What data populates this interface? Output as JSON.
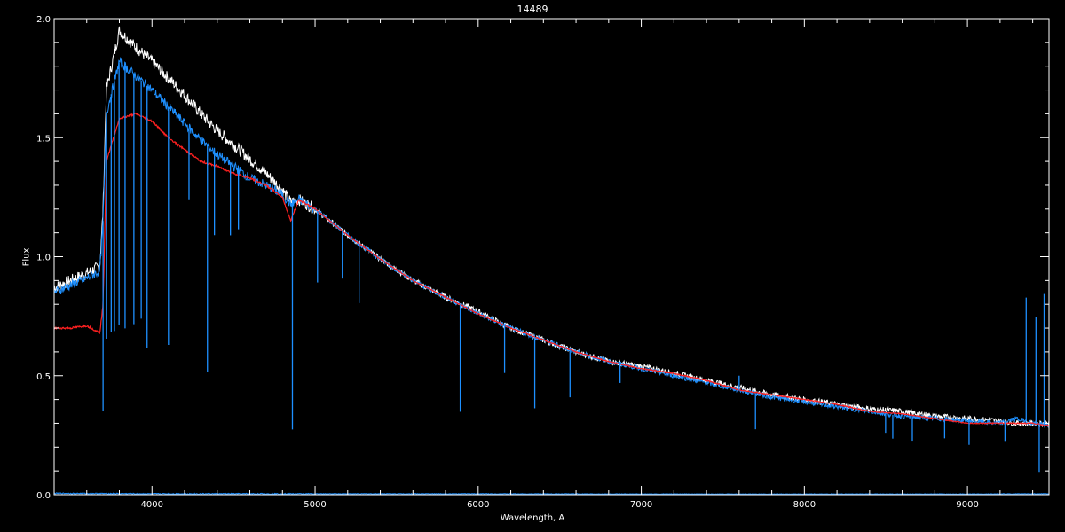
{
  "chart_data": {
    "type": "line",
    "title": "14489",
    "xlabel": "Wavelength, A",
    "ylabel": "Flux",
    "xlim": [
      3400,
      9500
    ],
    "ylim": [
      0.0,
      2.0
    ],
    "xticks": [
      4000,
      5000,
      6000,
      7000,
      8000,
      9000
    ],
    "xtick_labels": [
      "4000",
      "5000",
      "6000",
      "7000",
      "8000",
      "9000"
    ],
    "yticks": [
      0.0,
      0.5,
      1.0,
      1.5,
      2.0
    ],
    "ytick_labels": [
      "0.0",
      "0.5",
      "1.0",
      "1.5",
      "2.0"
    ],
    "grid": false,
    "series": [
      {
        "color": "#ffffff",
        "x": [
          3400,
          3500,
          3600,
          3680,
          3700,
          3720,
          3800,
          3900,
          4000,
          4100,
          4200,
          4300,
          4400,
          4500,
          4600,
          4700,
          4800,
          4850,
          4900,
          5000,
          5200,
          5400,
          5600,
          5800,
          6000,
          6200,
          6400,
          6600,
          6800,
          7000,
          7200,
          7400,
          7600,
          7800,
          8000,
          8200,
          8400,
          8600,
          8800,
          9000,
          9200,
          9300,
          9400,
          9500
        ],
        "y": [
          0.87,
          0.9,
          0.93,
          0.96,
          1.2,
          1.7,
          1.95,
          1.88,
          1.82,
          1.75,
          1.68,
          1.6,
          1.53,
          1.47,
          1.41,
          1.35,
          1.28,
          1.23,
          1.24,
          1.2,
          1.09,
          0.99,
          0.9,
          0.83,
          0.77,
          0.7,
          0.65,
          0.6,
          0.56,
          0.54,
          0.51,
          0.48,
          0.45,
          0.42,
          0.4,
          0.38,
          0.36,
          0.35,
          0.33,
          0.32,
          0.31,
          0.3,
          0.3,
          0.3
        ]
      },
      {
        "color": "#1e90ff",
        "x": [
          3400,
          3500,
          3600,
          3680,
          3700,
          3720,
          3800,
          3900,
          4000,
          4100,
          4200,
          4300,
          4400,
          4500,
          4600,
          4700,
          4800,
          4850,
          4900,
          5000,
          5200,
          5400,
          5600,
          5800,
          6000,
          6200,
          6400,
          6600,
          6800,
          7000,
          7200,
          7400,
          7600,
          7800,
          8000,
          8200,
          8400,
          8600,
          8800,
          9000,
          9200,
          9300,
          9400,
          9500
        ],
        "y": [
          0.85,
          0.88,
          0.91,
          0.94,
          1.15,
          1.6,
          1.82,
          1.76,
          1.7,
          1.63,
          1.56,
          1.49,
          1.43,
          1.38,
          1.33,
          1.3,
          1.26,
          1.22,
          1.24,
          1.2,
          1.09,
          0.99,
          0.9,
          0.83,
          0.76,
          0.7,
          0.65,
          0.6,
          0.56,
          0.53,
          0.5,
          0.47,
          0.44,
          0.41,
          0.39,
          0.37,
          0.35,
          0.33,
          0.32,
          0.31,
          0.3,
          0.32,
          0.3,
          0.29
        ]
      },
      {
        "color": "#ff2020",
        "x": [
          3400,
          3500,
          3600,
          3680,
          3700,
          3720,
          3800,
          3900,
          4000,
          4100,
          4200,
          4300,
          4400,
          4500,
          4600,
          4700,
          4800,
          4850,
          4900,
          5000,
          5200,
          5400,
          5600,
          5800,
          6000,
          6200,
          6400,
          6600,
          6800,
          7000,
          7200,
          7400,
          7600,
          7800,
          8000,
          8200,
          8400,
          8600,
          8800,
          9000,
          9200,
          9300,
          9400,
          9500
        ],
        "y": [
          0.7,
          0.7,
          0.71,
          0.68,
          0.8,
          1.4,
          1.58,
          1.6,
          1.57,
          1.5,
          1.45,
          1.4,
          1.38,
          1.35,
          1.33,
          1.3,
          1.25,
          1.15,
          1.24,
          1.2,
          1.09,
          0.99,
          0.9,
          0.83,
          0.76,
          0.7,
          0.65,
          0.6,
          0.56,
          0.53,
          0.51,
          0.48,
          0.44,
          0.42,
          0.4,
          0.38,
          0.35,
          0.34,
          0.32,
          0.3,
          0.3,
          0.3,
          0.3,
          0.29
        ]
      },
      {
        "color": "#1e90ff",
        "x": [
          3400,
          4000,
          5000,
          6000,
          7000,
          8000,
          9000,
          9500
        ],
        "y": [
          0.006,
          0.004,
          0.004,
          0.004,
          0.003,
          0.003,
          0.003,
          0.004
        ]
      }
    ],
    "absorption_lines": [
      {
        "x": 3700,
        "depth": 0.8
      },
      {
        "x": 3722,
        "depth": 0.95
      },
      {
        "x": 3750,
        "depth": 1.0
      },
      {
        "x": 3770,
        "depth": 1.05
      },
      {
        "x": 3798,
        "depth": 1.1
      },
      {
        "x": 3835,
        "depth": 1.1
      },
      {
        "x": 3889,
        "depth": 1.05
      },
      {
        "x": 3934,
        "depth": 1.0
      },
      {
        "x": 3970,
        "depth": 1.1
      },
      {
        "x": 4101,
        "depth": 1.0
      },
      {
        "x": 4227,
        "depth": 0.3
      },
      {
        "x": 4340,
        "depth": 0.95
      },
      {
        "x": 4383,
        "depth": 0.35
      },
      {
        "x": 4481,
        "depth": 0.3
      },
      {
        "x": 4530,
        "depth": 0.25
      },
      {
        "x": 4861,
        "depth": 0.95
      },
      {
        "x": 5015,
        "depth": 0.3
      },
      {
        "x": 5167,
        "depth": 0.2
      },
      {
        "x": 5270,
        "depth": 0.25
      },
      {
        "x": 5890,
        "depth": 0.45
      },
      {
        "x": 6162,
        "depth": 0.2
      },
      {
        "x": 6347,
        "depth": 0.3
      },
      {
        "x": 6563,
        "depth": 0.2
      },
      {
        "x": 6870,
        "depth": 0.08
      },
      {
        "x": 7700,
        "depth": 0.15
      },
      {
        "x": 8498,
        "depth": 0.08
      },
      {
        "x": 8542,
        "depth": 0.1
      },
      {
        "x": 8662,
        "depth": 0.1
      },
      {
        "x": 8860,
        "depth": 0.08
      },
      {
        "x": 9010,
        "depth": 0.1
      },
      {
        "x": 9230,
        "depth": 0.08
      },
      {
        "x": 9440,
        "depth": 0.2
      }
    ],
    "emission_spikes": [
      {
        "x": 7600,
        "height": 0.06
      },
      {
        "x": 9360,
        "height": 0.52
      },
      {
        "x": 9420,
        "height": 0.45
      },
      {
        "x": 9470,
        "height": 0.55
      }
    ]
  }
}
